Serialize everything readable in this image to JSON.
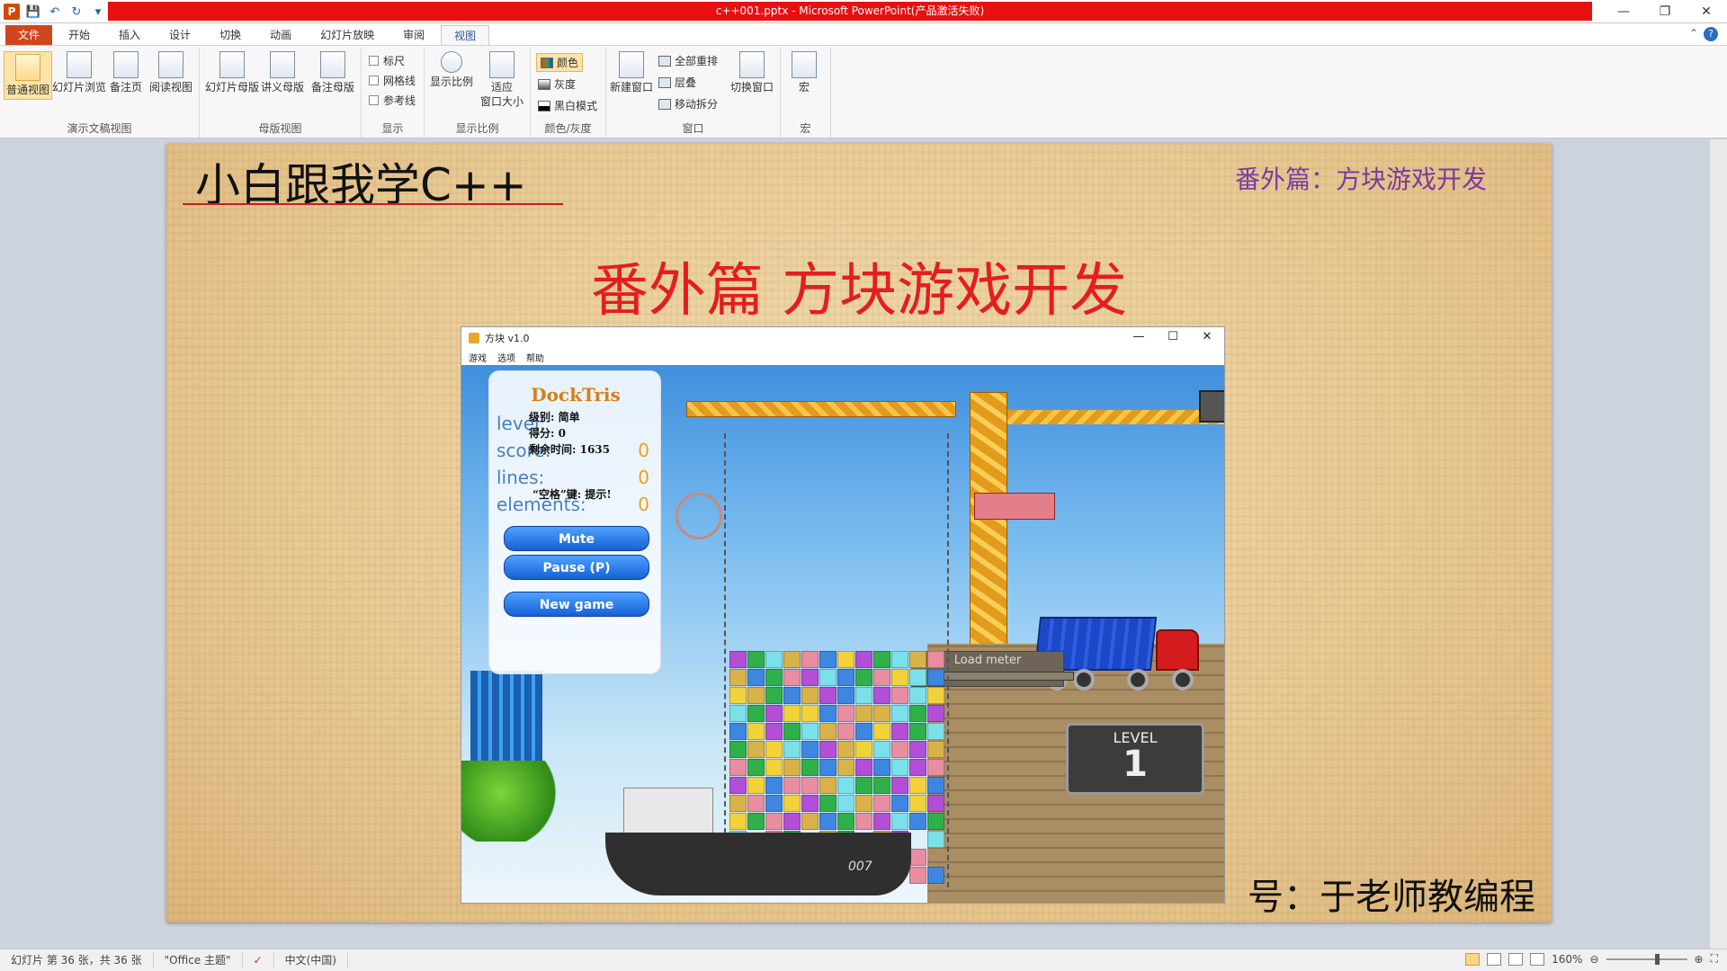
{
  "window": {
    "title": "c++001.pptx - Microsoft PowerPoint(产品激活失败)"
  },
  "qat": {
    "app_icon": "P",
    "save_icon": "💾",
    "undo_icon": "↶",
    "redo_icon": "↻",
    "more_icon": "▾"
  },
  "window_controls": {
    "minimize": "—",
    "restore": "❐",
    "close": "✕"
  },
  "tabs": [
    {
      "label": "文件"
    },
    {
      "label": "开始"
    },
    {
      "label": "插入"
    },
    {
      "label": "设计"
    },
    {
      "label": "切换"
    },
    {
      "label": "动画"
    },
    {
      "label": "幻灯片放映"
    },
    {
      "label": "审阅"
    },
    {
      "label": "视图"
    }
  ],
  "tab_right": {
    "minimize_ribbon": "⌃",
    "help": "?"
  },
  "ribbon": {
    "groups": {
      "presentation_views": {
        "label": "演示文稿视图",
        "buttons": [
          "普通视图",
          "幻灯片浏览",
          "备注页",
          "阅读视图"
        ]
      },
      "master_views": {
        "label": "母版视图",
        "buttons": [
          "幻灯片母版",
          "讲义母版",
          "备注母版"
        ]
      },
      "show": {
        "label": "显示",
        "checks": [
          "标尺",
          "网格线",
          "参考线"
        ]
      },
      "zoom": {
        "label": "显示比例",
        "buttons": [
          "显示比例",
          "适应\n窗口大小"
        ]
      },
      "color": {
        "label": "颜色/灰度",
        "items": [
          "颜色",
          "灰度",
          "黑白模式"
        ]
      },
      "window": {
        "label": "窗口",
        "new_window": "新建窗口",
        "items": [
          "全部重排",
          "层叠",
          "移动拆分"
        ],
        "switch": "切换窗口"
      },
      "macro": {
        "label": "宏",
        "button": "宏"
      }
    }
  },
  "slide": {
    "title": "小白跟我学C++",
    "subtitle": "番外篇：方块游戏开发",
    "heading": "番外篇 方块游戏开发",
    "footer": "号：于老师教编程"
  },
  "game": {
    "window_title": "方块 v1.0",
    "menu": [
      "游戏",
      "选项",
      "帮助"
    ],
    "controls": {
      "minimize": "—",
      "maximize": "☐",
      "close": "✕"
    },
    "logo": "DockTris",
    "labels": {
      "level": "level:",
      "score": "score:",
      "lines": "lines:",
      "elements": "elements:"
    },
    "values": {
      "score": "0",
      "lines": "0",
      "elements": "0"
    },
    "overlay_cn": {
      "level": "级别: 简单",
      "score": "得分: 0",
      "time": "剩余时间: 1635",
      "hint": "“空格”键: 提示!"
    },
    "buttons": {
      "mute": "Mute",
      "pause": "Pause (P)",
      "new_game": "New game"
    },
    "load_meter": "Load meter",
    "level_label": "LEVEL",
    "level_number": "1",
    "ship_number": "007"
  },
  "statusbar": {
    "slide_info": "幻灯片 第 36 张，共 36 张",
    "theme": "\"Office 主题\"",
    "language": "中文(中国)",
    "zoom": "160%"
  },
  "colors": {
    "file_tab": "#d0461c",
    "titlebar_alert": "#e81010",
    "slide_heading": "#e31e1e",
    "slide_subtitle": "#7b3aa0"
  }
}
